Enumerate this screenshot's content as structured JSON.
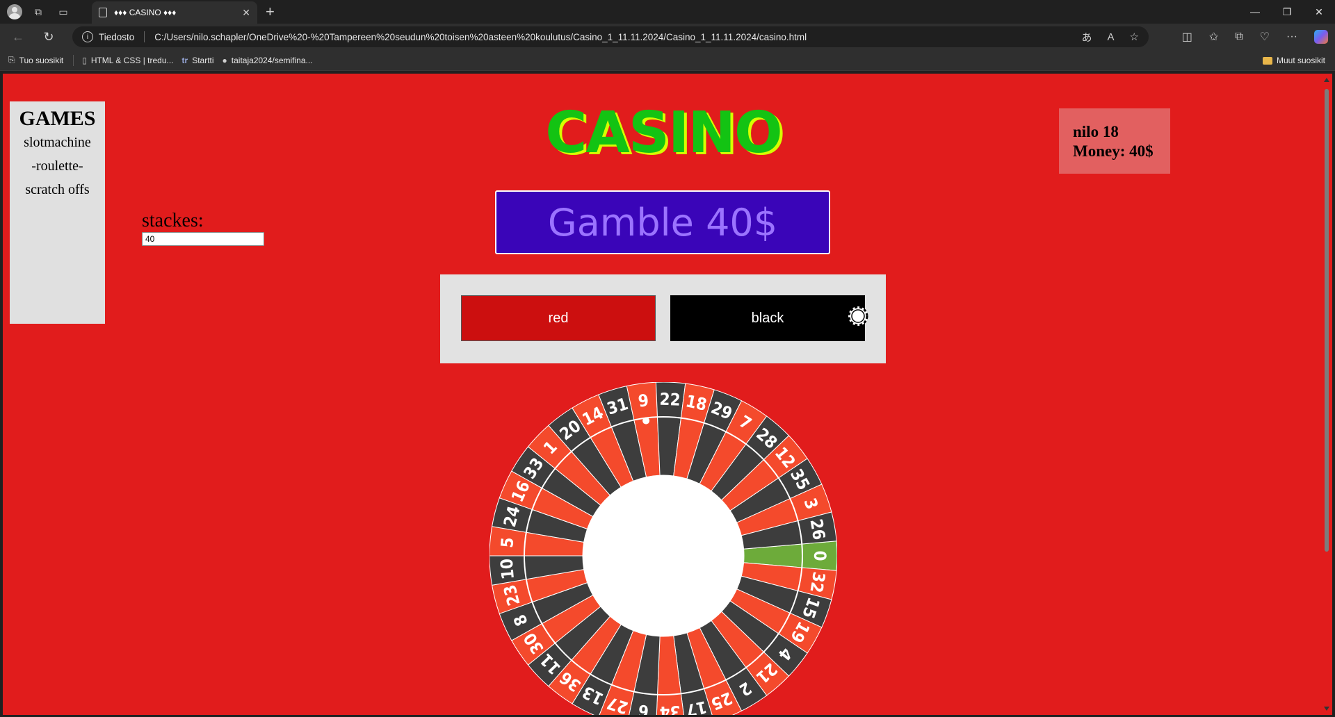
{
  "browser": {
    "tab_title": "♦♦♦ CASINO ♦♦♦",
    "address_scheme": "Tiedosto",
    "address_url": "C:/Users/nilo.schapler/OneDrive%20-%20Tampereen%20seudun%20toisen%20asteen%20koulutus/Casino_1_11.11.2024/Casino_1_11.11.2024/casino.html",
    "bookmarks": [
      {
        "label": "Tuo suosikit",
        "icon": "import-favorites-icon"
      },
      {
        "label": "HTML & CSS | tredu...",
        "icon": "document-icon"
      },
      {
        "label": "Startti",
        "icon": "startti-logo-icon"
      },
      {
        "label": "taitaja2024/semifina...",
        "icon": "github-icon"
      }
    ],
    "other_favorites": "Muut suosikit"
  },
  "sidebar": {
    "heading": "GAMES",
    "items": [
      "slotmachine",
      "-roulette-",
      "scratch offs"
    ]
  },
  "stake": {
    "label": "stackes:",
    "value": "40"
  },
  "logo": "CASINO",
  "gamble_button": "Gamble 40$",
  "bets": {
    "red_label": "red",
    "black_label": "black"
  },
  "player": {
    "name_line": "nilo 18",
    "money_line": "Money: 40$"
  },
  "roulette": {
    "numbers": [
      0,
      32,
      15,
      19,
      4,
      21,
      2,
      25,
      17,
      34,
      6,
      27,
      13,
      36,
      11,
      30,
      8,
      23,
      10,
      5,
      24,
      16,
      33,
      1,
      20,
      14,
      31,
      9,
      22,
      18,
      29,
      7,
      28,
      12,
      35,
      3,
      26
    ],
    "colors": {
      "red": "#f44a2c",
      "black": "#3d3d3d",
      "green": "#6dab3a",
      "center": "#ffffff"
    }
  }
}
